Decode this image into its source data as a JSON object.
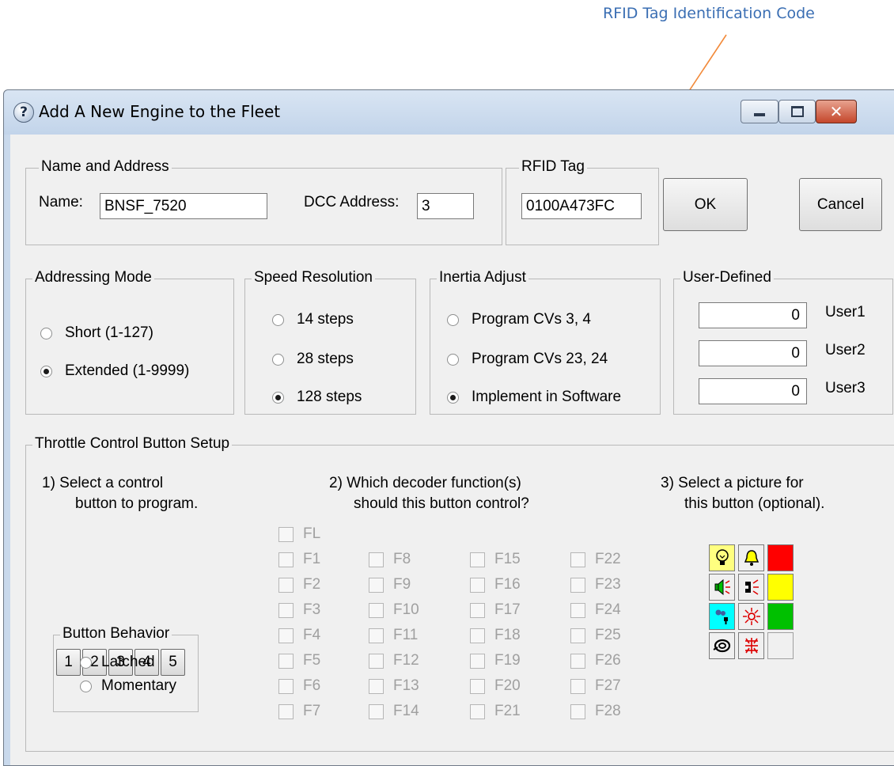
{
  "annotation": {
    "text": "RFID Tag Identification Code",
    "color": "#3a6eb3",
    "arrow_color": "#f28a3a"
  },
  "window": {
    "title": "Add A New Engine to the Fleet"
  },
  "name_address": {
    "title": "Name and Address",
    "name_label": "Name:",
    "name_value": "BNSF_7520",
    "dcc_label": "DCC Address:",
    "dcc_value": "3"
  },
  "rfid": {
    "title": "RFID Tag",
    "value": "0100A473FC"
  },
  "buttons": {
    "ok": "OK",
    "cancel": "Cancel"
  },
  "addressing_mode": {
    "title": "Addressing Mode",
    "options": [
      {
        "label": "Short  (1-127)",
        "selected": false
      },
      {
        "label": "Extended  (1-9999)",
        "selected": true
      }
    ]
  },
  "speed_resolution": {
    "title": "Speed Resolution",
    "options": [
      {
        "label": "14 steps",
        "selected": false
      },
      {
        "label": "28 steps",
        "selected": false
      },
      {
        "label": "128 steps",
        "selected": true
      }
    ]
  },
  "inertia_adjust": {
    "title": "Inertia Adjust",
    "options": [
      {
        "label": "Program CVs 3, 4",
        "selected": false
      },
      {
        "label": "Program CVs 23, 24",
        "selected": false
      },
      {
        "label": "Implement in Software",
        "selected": true
      }
    ]
  },
  "user_defined": {
    "title": "User-Defined",
    "fields": [
      {
        "value": "0",
        "label": "User1"
      },
      {
        "value": "0",
        "label": "User2"
      },
      {
        "value": "0",
        "label": "User3"
      }
    ]
  },
  "throttle": {
    "title": "Throttle Control Button Setup",
    "step1": [
      "1)  Select a control",
      "button to program."
    ],
    "step2": [
      "2)  Which decoder function(s)",
      "should this button control?"
    ],
    "step3": [
      "3)  Select a picture for",
      "this button (optional)."
    ],
    "control_buttons": [
      "1",
      "2",
      "3",
      "4",
      "5"
    ],
    "behavior": {
      "title": "Button Behavior",
      "options": [
        {
          "label": "Latched",
          "selected": false
        },
        {
          "label": "Momentary",
          "selected": false
        }
      ]
    },
    "functions": {
      "fl": "FL",
      "columns": [
        [
          "F1",
          "F2",
          "F3",
          "F4",
          "F5",
          "F6",
          "F7"
        ],
        [
          "F8",
          "F9",
          "F10",
          "F11",
          "F12",
          "F13",
          "F14"
        ],
        [
          "F15",
          "F16",
          "F17",
          "F18",
          "F19",
          "F20",
          "F21"
        ],
        [
          "F22",
          "F23",
          "F24",
          "F25",
          "F26",
          "F27",
          "F28"
        ]
      ]
    },
    "pictures": [
      [
        "light-bulb-icon",
        "bell-icon",
        "red-color"
      ],
      [
        "horn-speaker-icon",
        "coupler-horn-icon",
        "yellow-color"
      ],
      [
        "smoke-unit-icon",
        "flash-light-icon",
        "green-color"
      ],
      [
        "swirl-icon",
        "ditch-light-icon",
        "blank"
      ]
    ],
    "colors": {
      "red": "#ff0000",
      "yellow": "#ffff00",
      "green": "#00c000",
      "cyan": "#00ffff",
      "bulb_yellow": "#ffff80"
    }
  }
}
